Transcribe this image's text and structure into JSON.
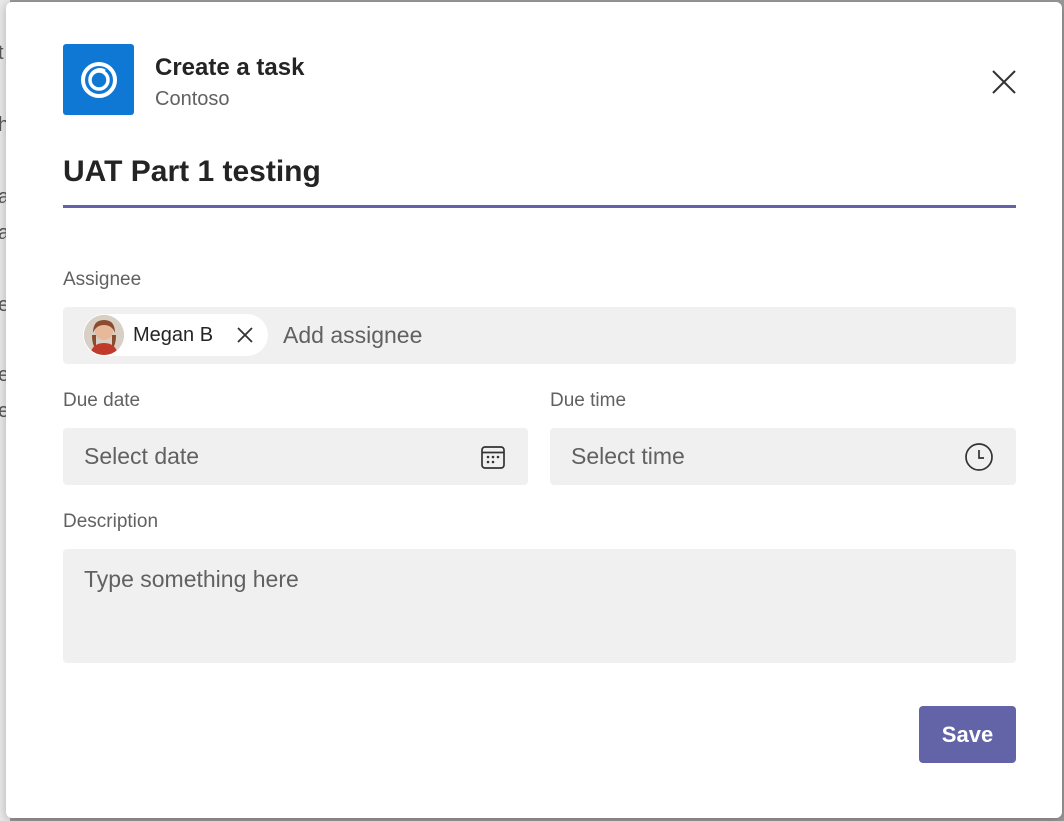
{
  "header": {
    "title": "Create a task",
    "subtitle": "Contoso",
    "logo_color": "#0f78d4",
    "close_icon": "close-icon"
  },
  "task": {
    "title": "UAT Part 1 testing",
    "underline_color": "#6264a7"
  },
  "assignee": {
    "label": "Assignee",
    "selected": [
      {
        "name": "Megan B"
      }
    ],
    "placeholder": "Add assignee"
  },
  "due_date": {
    "label": "Due date",
    "placeholder": "Select date",
    "icon": "calendar-icon"
  },
  "due_time": {
    "label": "Due time",
    "placeholder": "Select time",
    "icon": "clock-icon"
  },
  "description": {
    "label": "Description",
    "placeholder": "Type something here"
  },
  "actions": {
    "save_label": "Save",
    "accent": "#6264a7"
  },
  "backdrop": {
    "chars": [
      "t",
      "h",
      "a",
      "a",
      "e",
      "e",
      "e"
    ]
  }
}
